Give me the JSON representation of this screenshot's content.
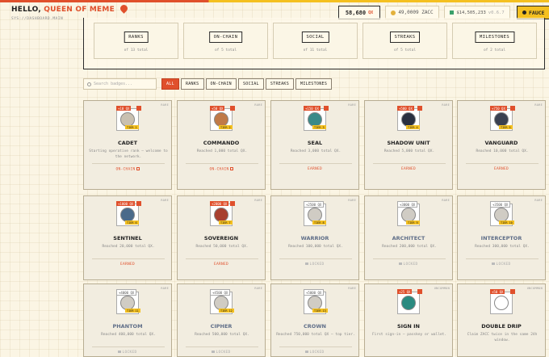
{
  "greeting": {
    "prefix": "HELLO,",
    "name": "QUEEN OF MEME"
  },
  "subtitle": "SYS://DASHBOARD.MAIN",
  "header": {
    "qx_value": "58,680",
    "qx_unit": "QX",
    "zacc": "49,0009 ZACC",
    "balance": "$14,505,233",
    "version": "v0.6.7",
    "faucet_label": "FAUCE"
  },
  "categories": [
    {
      "label": "RANKS",
      "count": "of 13 total"
    },
    {
      "label": "ON-CHAIN",
      "count": "of 5 total"
    },
    {
      "label": "SOCIAL",
      "count": "of 11 total"
    },
    {
      "label": "STREAKS",
      "count": "of 5 total"
    },
    {
      "label": "MILESTONES",
      "count": "of 2 total"
    }
  ],
  "search": {
    "placeholder": "Search badges..."
  },
  "filters": [
    "ALL",
    "RANKS",
    "ON-CHAIN",
    "SOCIAL",
    "STREAKS",
    "MILESTONES"
  ],
  "colors": {
    "accent": "#e0502c",
    "gold": "#f4c020",
    "success": "#3aa06a"
  },
  "badges": [
    {
      "rarity": "RARE",
      "reward": "+10 QX",
      "tier": "TIER 1",
      "name": "CADET",
      "desc": "Starting operative rank — welcome to the network.",
      "status": "ON-CHAIN",
      "state": "onchain",
      "icon": "cadet-badge-icon",
      "color": "#c9c0b0"
    },
    {
      "rarity": "RARE",
      "reward": "+50 QX",
      "tier": "TIER 2",
      "name": "COMMANDO",
      "desc": "Reached 1,000 total QX.",
      "status": "ON-CHAIN",
      "state": "onchain",
      "icon": "commando-badge-icon",
      "color": "#c07a48"
    },
    {
      "rarity": "RARE",
      "reward": "+150 QX",
      "tier": "TIER 3",
      "name": "SEAL",
      "desc": "Reached 3,000 total QX.",
      "status": "EARNED",
      "state": "earned",
      "icon": "seal-badge-icon",
      "color": "#3a8a88"
    },
    {
      "rarity": "RARE",
      "reward": "+500 QX",
      "tier": "TIER 4",
      "name": "SHADOW UNIT",
      "desc": "Reached 5,000 total QX.",
      "status": "EARNED",
      "state": "earned",
      "icon": "shadow-unit-badge-icon",
      "color": "#2a3040"
    },
    {
      "rarity": "RARE",
      "reward": "+750 QX",
      "tier": "TIER 5",
      "name": "VANGUARD",
      "desc": "Reached 10,000 total QX.",
      "status": "EARNED",
      "state": "earned",
      "icon": "vanguard-badge-icon",
      "color": "#3a4050"
    },
    {
      "rarity": "RARE",
      "reward": "+1000 QX",
      "tier": "TIER 6",
      "name": "SENTINEL",
      "desc": "Reached 20,000 total QX.",
      "status": "EARNED",
      "state": "earned",
      "icon": "sentinel-badge-icon",
      "color": "#4a6a8a"
    },
    {
      "rarity": "RARE",
      "reward": "+2000 QX",
      "tier": "TIER 7",
      "name": "SOVEREIGN",
      "desc": "Reached 50,000 total QX.",
      "status": "EARNED",
      "state": "earned",
      "icon": "sovereign-badge-icon",
      "color": "#a84030"
    },
    {
      "rarity": "RARE",
      "reward": "+2500 QX",
      "tier": "TIER 8",
      "name": "WARRIOR",
      "desc": "Reached 100,000 total QX.",
      "status": "LOCKED",
      "state": "locked",
      "icon": "warrior-badge-icon",
      "color": "#d0ccc4"
    },
    {
      "rarity": "RARE",
      "reward": "+3000 QX",
      "tier": "TIER 9",
      "name": "ARCHITECT",
      "desc": "Reached 200,000 total QX.",
      "status": "LOCKED",
      "state": "locked",
      "icon": "architect-badge-icon",
      "color": "#d0ccc4"
    },
    {
      "rarity": "RARE",
      "reward": "+3500 QX",
      "tier": "TIER 10",
      "name": "INTERCEPTOR",
      "desc": "Reached 300,000 total QX.",
      "status": "LOCKED",
      "state": "locked",
      "icon": "interceptor-badge-icon",
      "color": "#d0ccc4"
    },
    {
      "rarity": "RARE",
      "reward": "+4000 QX",
      "tier": "TIER 11",
      "name": "PHANTOM",
      "desc": "Reached 400,000 total QX.",
      "status": "LOCKED",
      "state": "locked",
      "icon": "phantom-badge-icon",
      "color": "#d0ccc4"
    },
    {
      "rarity": "RARE",
      "reward": "+4500 QX",
      "tier": "TIER 12",
      "name": "CIPHER",
      "desc": "Reached 500,000 total QX.",
      "status": "LOCKED",
      "state": "locked",
      "icon": "cipher-badge-icon",
      "color": "#d0ccc4"
    },
    {
      "rarity": "RARE",
      "reward": "+5000 QX",
      "tier": "TIER 13",
      "name": "CROWN",
      "desc": "Reached 750,000 total QX — top tier.",
      "status": "LOCKED",
      "state": "locked",
      "icon": "crown-badge-icon",
      "color": "#d0ccc4"
    },
    {
      "rarity": "UNCOMMON",
      "reward": "+25 QX",
      "tier": "",
      "name": "SIGN IN",
      "desc": "First sign-in — passkey or wallet.",
      "status": "",
      "state": "earned",
      "icon": "wallet-icon",
      "color": "#2a8a80"
    },
    {
      "rarity": "UNCOMMON",
      "reward": "+50 QX",
      "tier": "",
      "name": "DOUBLE DRIP",
      "desc": "Claim ZACC twice in the same 24h window.",
      "status": "",
      "state": "earned",
      "icon": "drip-icon",
      "color": "#ffffff"
    }
  ]
}
